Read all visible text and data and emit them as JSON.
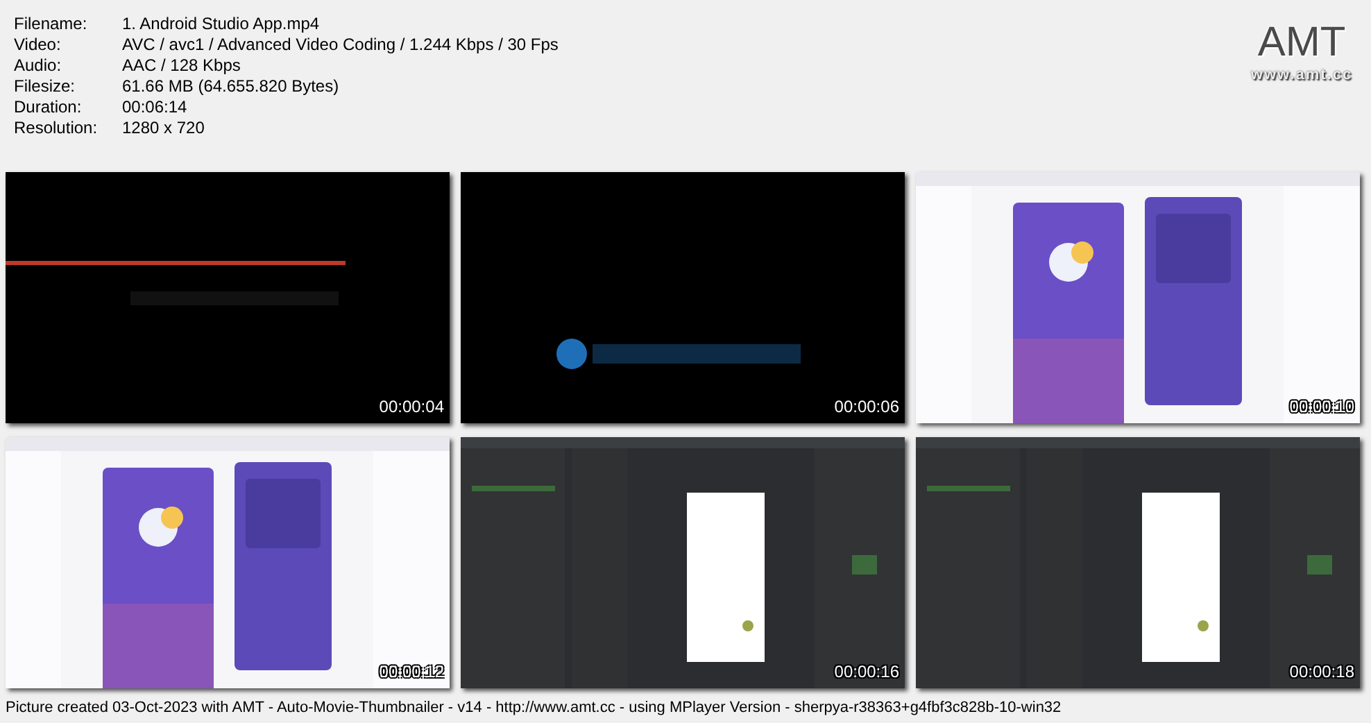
{
  "info": [
    {
      "label": "Filename:",
      "value": "1. Android Studio App.mp4"
    },
    {
      "label": "Video:",
      "value": "AVC / avc1 / Advanced Video Coding / 1.244 Kbps / 30 Fps"
    },
    {
      "label": "Audio:",
      "value": "AAC / 128 Kbps"
    },
    {
      "label": "Filesize:",
      "value": "61.66 MB (64.655.820 Bytes)"
    },
    {
      "label": "Duration:",
      "value": "00:06:14"
    },
    {
      "label": "Resolution:",
      "value": "1280 x 720"
    }
  ],
  "logo": {
    "title": "AMT",
    "url": "www.amt.cc"
  },
  "thumbnails": [
    {
      "kind": "picture",
      "time": "00:00:04"
    },
    {
      "kind": "picture",
      "time": "00:00:06"
    },
    {
      "kind": "picture",
      "time": "00:00:10"
    },
    {
      "kind": "picture",
      "time": "00:00:12"
    },
    {
      "kind": "picture",
      "time": "00:00:16"
    },
    {
      "kind": "picture",
      "time": "00:00:18"
    }
  ],
  "footer": "Picture created 03-Oct-2023 with AMT - Auto-Movie-Thumbnailer - v14 - http://www.amt.cc - using MPlayer Version - sherpya-r38363+g4fbf3c828b-10-win32"
}
